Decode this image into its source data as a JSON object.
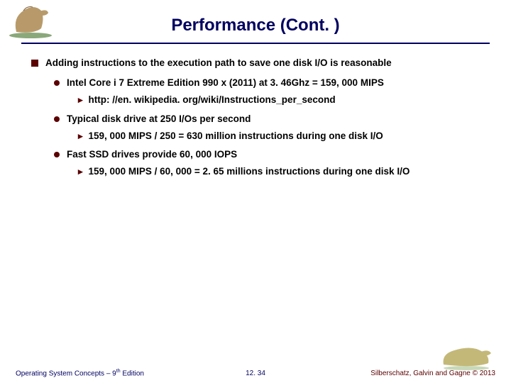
{
  "title": "Performance (Cont. )",
  "main": {
    "text": "Adding instructions to the execution path to save one disk I/O is reasonable",
    "subs": [
      {
        "text": "Intel Core i 7 Extreme Edition 990 x (2011) at 3. 46Ghz = 159, 000 MIPS",
        "subs": [
          {
            "text": "http: //en. wikipedia. org/wiki/Instructions_per_second"
          }
        ]
      },
      {
        "text": "Typical disk drive at 250 I/Os per second",
        "subs": [
          {
            "text": "159, 000 MIPS / 250 = 630 million instructions during one disk I/O"
          }
        ]
      },
      {
        "text": "Fast SSD drives provide 60, 000 IOPS",
        "subs": [
          {
            "text": "159, 000 MIPS / 60, 000 = 2. 65 millions instructions during one disk I/O"
          }
        ]
      }
    ]
  },
  "footer": {
    "left_a": "Operating System Concepts – 9",
    "left_b": " Edition",
    "left_sup": "th",
    "center": "12. 34",
    "right": "Silberschatz, Galvin and Gagne © 2013"
  }
}
